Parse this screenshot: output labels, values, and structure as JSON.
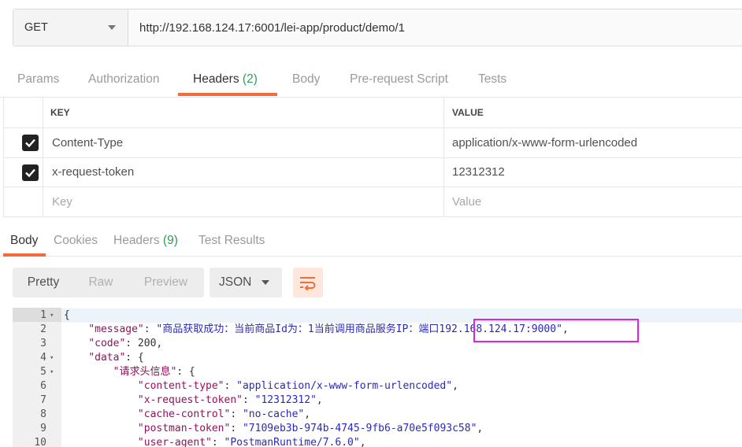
{
  "request": {
    "method": "GET",
    "url": "http://192.168.124.17:6001/lei-app/product/demo/1"
  },
  "request_tabs": [
    {
      "label": "Params",
      "count": ""
    },
    {
      "label": "Authorization",
      "count": ""
    },
    {
      "label": "Headers ",
      "count": "(2)"
    },
    {
      "label": "Body",
      "count": ""
    },
    {
      "label": "Pre-request Script",
      "count": ""
    },
    {
      "label": "Tests",
      "count": ""
    }
  ],
  "headers_table": {
    "columns": [
      "KEY",
      "VALUE"
    ],
    "rows": [
      {
        "checked": true,
        "key": "Content-Type",
        "value": "application/x-www-form-urlencoded"
      },
      {
        "checked": true,
        "key": "x-request-token",
        "value": "12312312"
      }
    ],
    "new_row": {
      "key_placeholder": "Key",
      "value_placeholder": "Value"
    }
  },
  "response_tabs": [
    {
      "label": "Body",
      "count": ""
    },
    {
      "label": "Cookies",
      "count": ""
    },
    {
      "label": "Headers ",
      "count": "(9)"
    },
    {
      "label": "Test Results",
      "count": ""
    }
  ],
  "response_toolbar": {
    "views": [
      "Pretty",
      "Raw",
      "Preview"
    ],
    "format": "JSON"
  },
  "code_lines": [
    {
      "n": "1",
      "parts": [
        {
          "c": "n",
          "t": "{"
        }
      ]
    },
    {
      "n": "2",
      "parts": [
        {
          "c": "n",
          "t": "    "
        },
        {
          "c": "k",
          "t": "\"message\""
        },
        {
          "c": "n",
          "t": ": "
        },
        {
          "c": "s",
          "t": "\"商品获取成功：当前商品Id为：1当前调用商品服务IP：端口192.168.124.17:9000\""
        },
        {
          "c": "n",
          "t": ","
        }
      ]
    },
    {
      "n": "3",
      "parts": [
        {
          "c": "n",
          "t": "    "
        },
        {
          "c": "k",
          "t": "\"code\""
        },
        {
          "c": "n",
          "t": ": 200,"
        }
      ]
    },
    {
      "n": "4",
      "parts": [
        {
          "c": "n",
          "t": "    "
        },
        {
          "c": "k",
          "t": "\"data\""
        },
        {
          "c": "n",
          "t": ": {"
        }
      ]
    },
    {
      "n": "5",
      "parts": [
        {
          "c": "n",
          "t": "        "
        },
        {
          "c": "k",
          "t": "\"请求头信息\""
        },
        {
          "c": "n",
          "t": ": {"
        }
      ]
    },
    {
      "n": "6",
      "parts": [
        {
          "c": "n",
          "t": "            "
        },
        {
          "c": "k",
          "t": "\"content-type\""
        },
        {
          "c": "n",
          "t": ": "
        },
        {
          "c": "s",
          "t": "\"application/x-www-form-urlencoded\""
        },
        {
          "c": "n",
          "t": ","
        }
      ]
    },
    {
      "n": "7",
      "parts": [
        {
          "c": "n",
          "t": "            "
        },
        {
          "c": "k",
          "t": "\"x-request-token\""
        },
        {
          "c": "n",
          "t": ": "
        },
        {
          "c": "s",
          "t": "\"12312312\""
        },
        {
          "c": "n",
          "t": ","
        }
      ]
    },
    {
      "n": "8",
      "parts": [
        {
          "c": "n",
          "t": "            "
        },
        {
          "c": "k",
          "t": "\"cache-control\""
        },
        {
          "c": "n",
          "t": ": "
        },
        {
          "c": "s",
          "t": "\"no-cache\""
        },
        {
          "c": "n",
          "t": ","
        }
      ]
    },
    {
      "n": "9",
      "parts": [
        {
          "c": "n",
          "t": "            "
        },
        {
          "c": "k",
          "t": "\"postman-token\""
        },
        {
          "c": "n",
          "t": ": "
        },
        {
          "c": "s",
          "t": "\"7109eb3b-974b-4745-9fb6-a70e5f093c58\""
        },
        {
          "c": "n",
          "t": ","
        }
      ]
    },
    {
      "n": "10",
      "parts": [
        {
          "c": "n",
          "t": "            "
        },
        {
          "c": "k",
          "t": "\"user-agent\""
        },
        {
          "c": "n",
          "t": ": "
        },
        {
          "c": "s",
          "t": "\"PostmanRuntime/7.6.0\""
        },
        {
          "c": "n",
          "t": ","
        }
      ]
    }
  ],
  "fold_lines": [
    "1",
    "4",
    "5"
  ],
  "colors": {
    "accent": "#f26b3a",
    "count": "#2e9c57",
    "json_key": "#9a0d5e",
    "json_string": "#2a2ab6",
    "annotation": "#e022e0"
  }
}
